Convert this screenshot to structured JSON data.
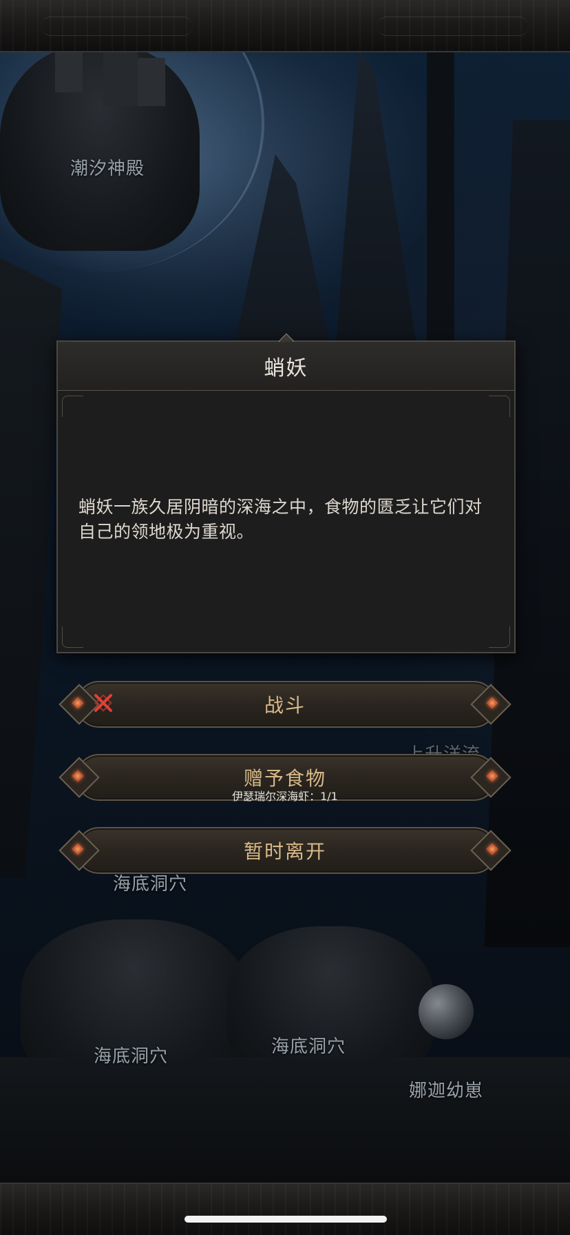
{
  "map": {
    "labels": {
      "tidal_temple": "潮汐神殿",
      "seafloor_cave_mid": "海底洞穴",
      "seafloor_cave_left": "海底洞穴",
      "seafloor_cave_right": "海底洞穴",
      "upwelling_partial": "上升洋流",
      "naga_nest": "娜迦幼崽"
    }
  },
  "dialog": {
    "title": "蛸妖",
    "body": "蛸妖一族久居阴暗的深海之中，食物的匮乏让它们对自己的领地极为重视。"
  },
  "options": [
    {
      "label": "战斗",
      "icon": "crossed-swords-icon",
      "accent": "#c0302a"
    },
    {
      "label": "赠予食物",
      "sub": "伊瑟瑞尔深海虾：1/1"
    },
    {
      "label": "暂时离开"
    }
  ],
  "colors": {
    "option_text": "#d9b989",
    "gem": "#e07040",
    "dialog_bg": "#1e1d1d"
  }
}
